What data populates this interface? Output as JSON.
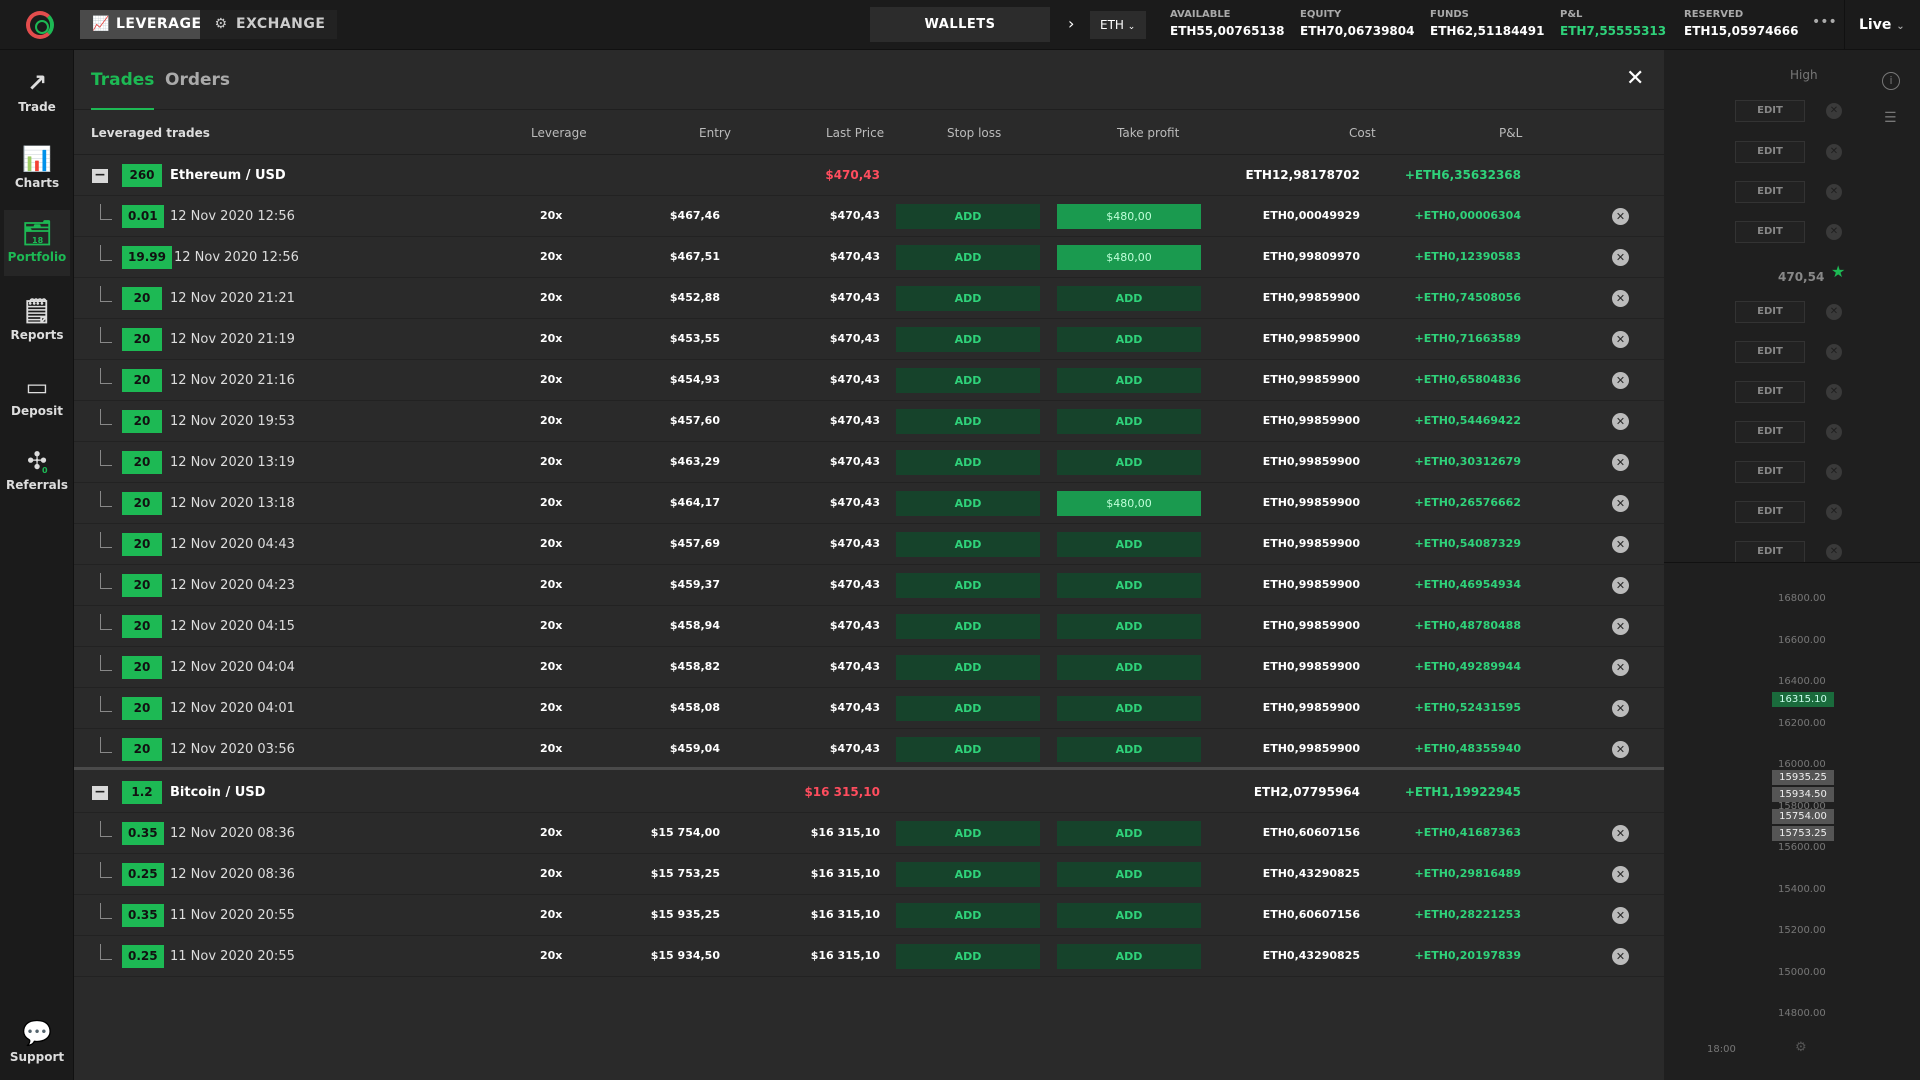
{
  "topbar": {
    "modes": [
      {
        "label": "LEVERAGE",
        "icon": "chart-line-icon",
        "active": true
      },
      {
        "label": "EXCHANGE",
        "icon": "exchange-icon",
        "active": false
      }
    ],
    "wallets_label": "WALLETS",
    "currency": "ETH",
    "stats": [
      {
        "label": "AVAILABLE",
        "value": "ETH55,00765138"
      },
      {
        "label": "EQUITY",
        "value": "ETH70,06739804"
      },
      {
        "label": "FUNDS",
        "value": "ETH62,51184491"
      },
      {
        "label": "P&L",
        "value": "ETH7,55555313"
      },
      {
        "label": "RESERVED",
        "value": "ETH15,05974666"
      }
    ],
    "mode_select": "Live"
  },
  "sidebar": {
    "items": [
      {
        "label": "Trade",
        "icon": "trade-chart-icon"
      },
      {
        "label": "Charts",
        "icon": "charts-icon"
      },
      {
        "label": "Portfolio",
        "icon": "portfolio-icon",
        "badge": "18"
      },
      {
        "label": "Reports",
        "icon": "reports-icon"
      },
      {
        "label": "Deposit",
        "icon": "deposit-card-icon"
      },
      {
        "label": "Referrals",
        "icon": "referrals-network-icon",
        "badge": "0"
      }
    ],
    "support_label": "Support"
  },
  "background": {
    "high_label": "High",
    "edit_label": "EDIT",
    "price_470": "470,54",
    "axis": [
      "16800.00",
      "16600.00",
      "16400.00",
      "16200.00",
      "16000.00",
      "15800.00",
      "15600.00",
      "15400.00",
      "15200.00",
      "15000.00",
      "14800.00"
    ],
    "tags": [
      "16315.10",
      "15935.25",
      "15934.50",
      "15754.00",
      "15753.25"
    ],
    "time_label": "18:00"
  },
  "panel": {
    "tabs": [
      "Trades",
      "Orders"
    ],
    "headers": {
      "name": "Leveraged trades",
      "leverage": "Leverage",
      "entry": "Entry",
      "last": "Last Price",
      "stop": "Stop loss",
      "take": "Take profit",
      "cost": "Cost",
      "pnl": "P&L"
    },
    "add_label": "ADD",
    "groups": [
      {
        "qty": "260",
        "name": "Ethereum / USD",
        "last": "$470,43",
        "cost": "ETH12,98178702",
        "pnl": "+ETH6,35632368",
        "trades": [
          {
            "qty": "0.01",
            "date": "12 Nov 2020 12:56",
            "lev": "20x",
            "entry": "$467,46",
            "last": "$470,43",
            "tp": "$480,00",
            "cost": "ETH0,00049929",
            "pnl": "+ETH0,00006304"
          },
          {
            "qty": "19.99",
            "date": "12 Nov 2020 12:56",
            "lev": "20x",
            "entry": "$467,51",
            "last": "$470,43",
            "tp": "$480,00",
            "cost": "ETH0,99809970",
            "pnl": "+ETH0,12390583"
          },
          {
            "qty": "20",
            "date": "12 Nov 2020 21:21",
            "lev": "20x",
            "entry": "$452,88",
            "last": "$470,43",
            "tp": "",
            "cost": "ETH0,99859900",
            "pnl": "+ETH0,74508056"
          },
          {
            "qty": "20",
            "date": "12 Nov 2020 21:19",
            "lev": "20x",
            "entry": "$453,55",
            "last": "$470,43",
            "tp": "",
            "cost": "ETH0,99859900",
            "pnl": "+ETH0,71663589"
          },
          {
            "qty": "20",
            "date": "12 Nov 2020 21:16",
            "lev": "20x",
            "entry": "$454,93",
            "last": "$470,43",
            "tp": "",
            "cost": "ETH0,99859900",
            "pnl": "+ETH0,65804836"
          },
          {
            "qty": "20",
            "date": "12 Nov 2020 19:53",
            "lev": "20x",
            "entry": "$457,60",
            "last": "$470,43",
            "tp": "",
            "cost": "ETH0,99859900",
            "pnl": "+ETH0,54469422"
          },
          {
            "qty": "20",
            "date": "12 Nov 2020 13:19",
            "lev": "20x",
            "entry": "$463,29",
            "last": "$470,43",
            "tp": "",
            "cost": "ETH0,99859900",
            "pnl": "+ETH0,30312679"
          },
          {
            "qty": "20",
            "date": "12 Nov 2020 13:18",
            "lev": "20x",
            "entry": "$464,17",
            "last": "$470,43",
            "tp": "$480,00",
            "cost": "ETH0,99859900",
            "pnl": "+ETH0,26576662"
          },
          {
            "qty": "20",
            "date": "12 Nov 2020 04:43",
            "lev": "20x",
            "entry": "$457,69",
            "last": "$470,43",
            "tp": "",
            "cost": "ETH0,99859900",
            "pnl": "+ETH0,54087329"
          },
          {
            "qty": "20",
            "date": "12 Nov 2020 04:23",
            "lev": "20x",
            "entry": "$459,37",
            "last": "$470,43",
            "tp": "",
            "cost": "ETH0,99859900",
            "pnl": "+ETH0,46954934"
          },
          {
            "qty": "20",
            "date": "12 Nov 2020 04:15",
            "lev": "20x",
            "entry": "$458,94",
            "last": "$470,43",
            "tp": "",
            "cost": "ETH0,99859900",
            "pnl": "+ETH0,48780488"
          },
          {
            "qty": "20",
            "date": "12 Nov 2020 04:04",
            "lev": "20x",
            "entry": "$458,82",
            "last": "$470,43",
            "tp": "",
            "cost": "ETH0,99859900",
            "pnl": "+ETH0,49289944"
          },
          {
            "qty": "20",
            "date": "12 Nov 2020 04:01",
            "lev": "20x",
            "entry": "$458,08",
            "last": "$470,43",
            "tp": "",
            "cost": "ETH0,99859900",
            "pnl": "+ETH0,52431595"
          },
          {
            "qty": "20",
            "date": "12 Nov 2020 03:56",
            "lev": "20x",
            "entry": "$459,04",
            "last": "$470,43",
            "tp": "",
            "cost": "ETH0,99859900",
            "pnl": "+ETH0,48355940"
          }
        ]
      },
      {
        "qty": "1.2",
        "name": "Bitcoin / USD",
        "last": "$16 315,10",
        "cost": "ETH2,07795964",
        "pnl": "+ETH1,19922945",
        "trades": [
          {
            "qty": "0.35",
            "date": "12 Nov 2020 08:36",
            "lev": "20x",
            "entry": "$15 754,00",
            "last": "$16 315,10",
            "tp": "",
            "cost": "ETH0,60607156",
            "pnl": "+ETH0,41687363"
          },
          {
            "qty": "0.25",
            "date": "12 Nov 2020 08:36",
            "lev": "20x",
            "entry": "$15 753,25",
            "last": "$16 315,10",
            "tp": "",
            "cost": "ETH0,43290825",
            "pnl": "+ETH0,29816489"
          },
          {
            "qty": "0.35",
            "date": "11 Nov 2020 20:55",
            "lev": "20x",
            "entry": "$15 935,25",
            "last": "$16 315,10",
            "tp": "",
            "cost": "ETH0,60607156",
            "pnl": "+ETH0,28221253"
          },
          {
            "qty": "0.25",
            "date": "11 Nov 2020 20:55",
            "lev": "20x",
            "entry": "$15 934,50",
            "last": "$16 315,10",
            "tp": "",
            "cost": "ETH0,43290825",
            "pnl": "+ETH0,20197839"
          }
        ]
      }
    ]
  },
  "colors": {
    "accent": "#1db954",
    "negative": "#ff4d5e",
    "positive": "#2fd27a"
  }
}
